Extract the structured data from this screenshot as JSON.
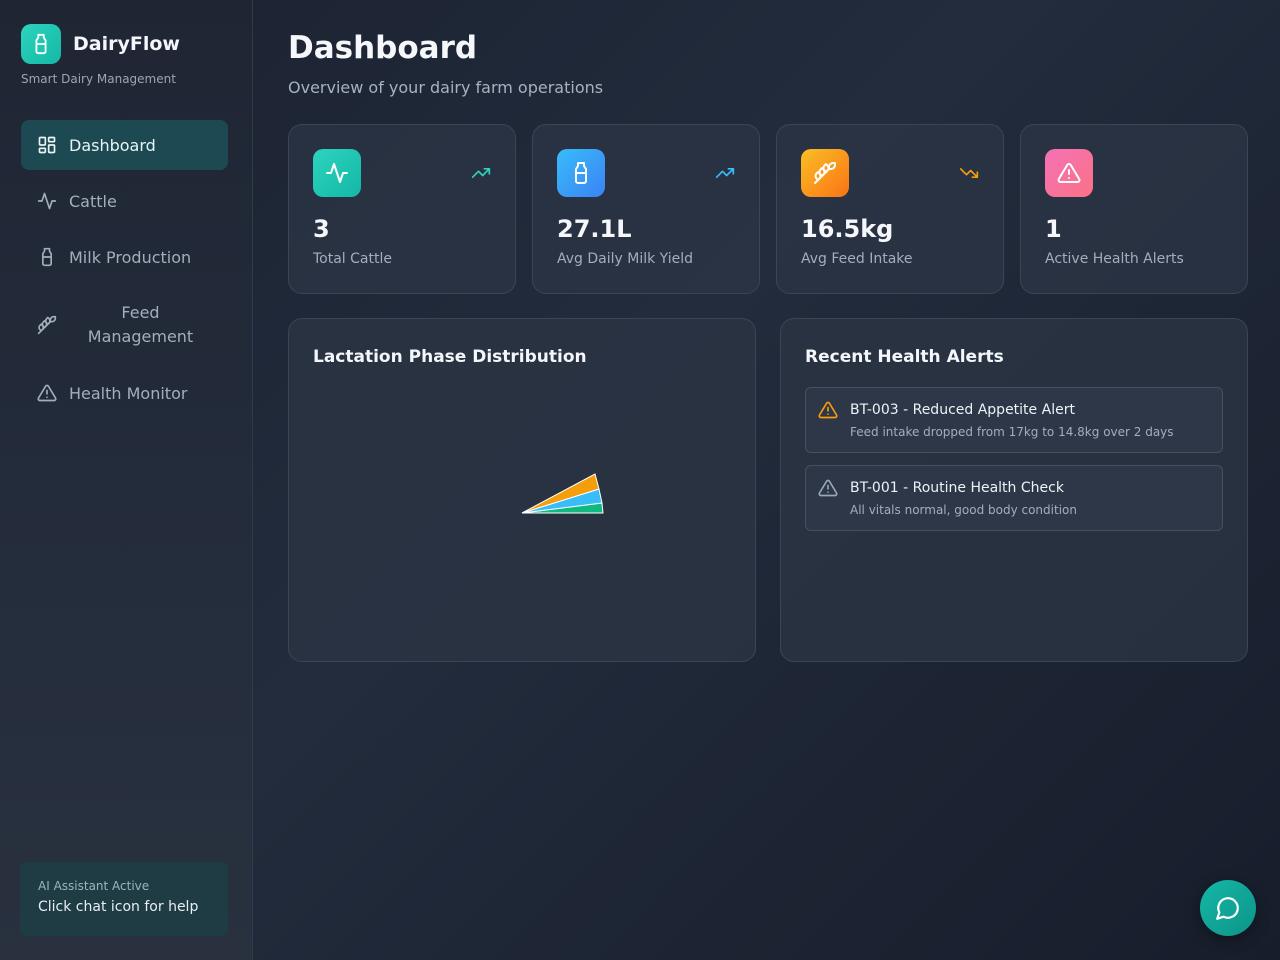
{
  "brand": {
    "name": "DairyFlow",
    "subtitle": "Smart Dairy Management",
    "logo_icon": "milk-bottle-icon"
  },
  "sidebar": {
    "items": [
      {
        "label": "Dashboard",
        "icon": "grid-icon",
        "active": true
      },
      {
        "label": "Cattle",
        "icon": "activity-icon",
        "active": false
      },
      {
        "label": "Milk Production",
        "icon": "milk-bottle-icon",
        "active": false
      },
      {
        "label": "Feed Management",
        "icon": "wheat-icon",
        "active": false
      },
      {
        "label": "Health Monitor",
        "icon": "warning-icon",
        "active": false
      }
    ],
    "ai": {
      "title": "AI Assistant Active",
      "text": "Click chat icon for help"
    }
  },
  "header": {
    "title": "Dashboard",
    "subtitle": "Overview of your dairy farm operations"
  },
  "stats": [
    {
      "value": "3",
      "label": "Total Cattle",
      "icon": "activity-icon",
      "color": "#2dd4bf",
      "trend": "up",
      "trend_color": "#2dd4bf"
    },
    {
      "value": "27.1L",
      "label": "Avg Daily Milk Yield",
      "icon": "milk-bottle-icon",
      "color": "#38bdf8",
      "trend": "up",
      "trend_color": "#38bdf8"
    },
    {
      "value": "16.5kg",
      "label": "Avg Feed Intake",
      "icon": "wheat-icon",
      "color": "#fb923c",
      "trend": "down",
      "trend_color": "#f59e0b"
    },
    {
      "value": "1",
      "label": "Active Health Alerts",
      "icon": "warning-icon",
      "color": "#f472b6",
      "trend": "none"
    }
  ],
  "lactation": {
    "title": "Lactation Phase Distribution",
    "slice_colors": [
      "#f59e0b",
      "#38bdf8",
      "#10b981"
    ]
  },
  "alerts_panel": {
    "title": "Recent Health Alerts",
    "items": [
      {
        "title": "BT-003 - Reduced Appetite Alert",
        "desc": "Feed intake dropped from 17kg to 14.8kg over 2 days",
        "icon": "warning-icon",
        "color": "#f59e0b"
      },
      {
        "title": "BT-001 - Routine Health Check",
        "desc": "All vitals normal, good body condition",
        "icon": "warning-icon",
        "color": "#9aa6b8"
      }
    ]
  },
  "chat": {
    "icon": "chat-bubble-icon"
  }
}
